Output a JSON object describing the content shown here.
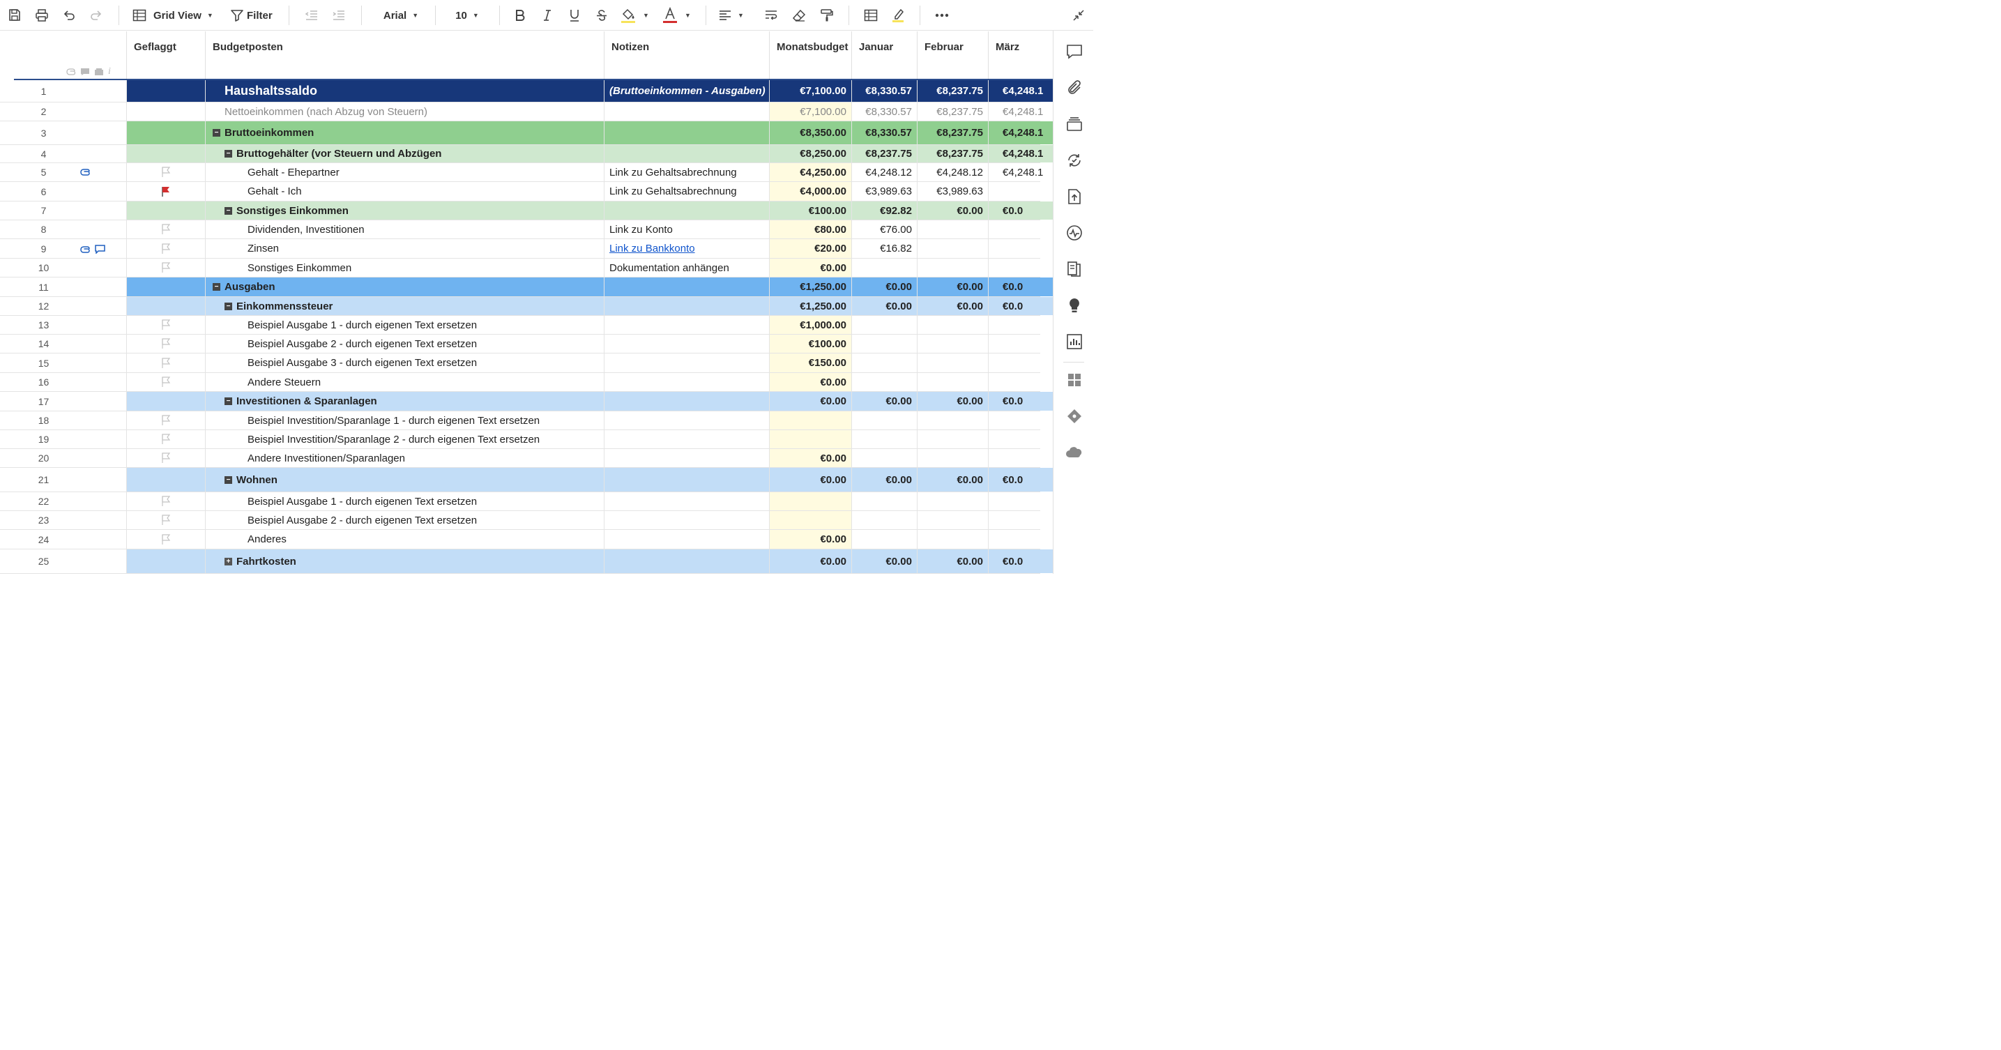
{
  "toolbar": {
    "view_label": "Grid View",
    "filter_label": "Filter",
    "font_family": "Arial",
    "font_size": "10",
    "fill_color": "#f7e35a",
    "text_color": "#d32f2f"
  },
  "columns": {
    "flagged": "Geflaggt",
    "item": "Budgetposten",
    "notes": "Notizen",
    "monthly": "Monatsbudget",
    "jan": "Januar",
    "feb": "Februar",
    "mar": "März"
  },
  "colors": {
    "balance_bg": "#17377a",
    "income_bg": "#8fcf8f",
    "income_sub_bg": "#cfe8cf",
    "expense_bg": "#6fb3f0",
    "expense_sub_bg": "#c2ddf7",
    "budget_col_bg": "#fffbe0",
    "flag_red": "#d32f2f"
  },
  "rows": [
    {
      "n": "1",
      "item": "Haushaltssaldo",
      "notes": "(Bruttoeinkommen - Ausgaben)",
      "mb": "€7,100.00",
      "jan": "€8,330.57",
      "feb": "€8,237.75",
      "mar": "€4,248.1"
    },
    {
      "n": "2",
      "item": "Nettoeinkommen (nach Abzug von Steuern)",
      "notes": "",
      "mb": "€7,100.00",
      "jan": "€8,330.57",
      "feb": "€8,237.75",
      "mar": "€4,248.1"
    },
    {
      "n": "3",
      "item": "Bruttoeinkommen",
      "notes": "",
      "mb": "€8,350.00",
      "jan": "€8,330.57",
      "feb": "€8,237.75",
      "mar": "€4,248.1"
    },
    {
      "n": "4",
      "item": "Bruttogehälter (vor Steuern und Abzügen",
      "notes": "",
      "mb": "€8,250.00",
      "jan": "€8,237.75",
      "feb": "€8,237.75",
      "mar": "€4,248.1"
    },
    {
      "n": "5",
      "item": "Gehalt - Ehepartner",
      "notes": "Link zu Gehaltsabrechnung",
      "mb": "€4,250.00",
      "jan": "€4,248.12",
      "feb": "€4,248.12",
      "mar": "€4,248.1"
    },
    {
      "n": "6",
      "item": "Gehalt - Ich",
      "notes": "Link zu Gehaltsabrechnung",
      "mb": "€4,000.00",
      "jan": "€3,989.63",
      "feb": "€3,989.63",
      "mar": ""
    },
    {
      "n": "7",
      "item": "Sonstiges Einkommen",
      "notes": "",
      "mb": "€100.00",
      "jan": "€92.82",
      "feb": "€0.00",
      "mar": "€0.0"
    },
    {
      "n": "8",
      "item": "Dividenden, Investitionen",
      "notes": "Link zu Konto",
      "mb": "€80.00",
      "jan": "€76.00",
      "feb": "",
      "mar": ""
    },
    {
      "n": "9",
      "item": "Zinsen",
      "notes": "Link zu Bankkonto",
      "mb": "€20.00",
      "jan": "€16.82",
      "feb": "",
      "mar": ""
    },
    {
      "n": "10",
      "item": "Sonstiges Einkommen",
      "notes": "Dokumentation anhängen",
      "mb": "€0.00",
      "jan": "",
      "feb": "",
      "mar": ""
    },
    {
      "n": "11",
      "item": "Ausgaben",
      "notes": "",
      "mb": "€1,250.00",
      "jan": "€0.00",
      "feb": "€0.00",
      "mar": "€0.0"
    },
    {
      "n": "12",
      "item": "Einkommenssteuer",
      "notes": "",
      "mb": "€1,250.00",
      "jan": "€0.00",
      "feb": "€0.00",
      "mar": "€0.0"
    },
    {
      "n": "13",
      "item": "Beispiel Ausgabe 1 - durch eigenen Text ersetzen",
      "notes": "",
      "mb": "€1,000.00",
      "jan": "",
      "feb": "",
      "mar": ""
    },
    {
      "n": "14",
      "item": "Beispiel Ausgabe 2 - durch eigenen Text ersetzen",
      "notes": "",
      "mb": "€100.00",
      "jan": "",
      "feb": "",
      "mar": ""
    },
    {
      "n": "15",
      "item": "Beispiel Ausgabe 3 - durch eigenen Text ersetzen",
      "notes": "",
      "mb": "€150.00",
      "jan": "",
      "feb": "",
      "mar": ""
    },
    {
      "n": "16",
      "item": "Andere Steuern",
      "notes": "",
      "mb": "€0.00",
      "jan": "",
      "feb": "",
      "mar": ""
    },
    {
      "n": "17",
      "item": "Investitionen & Sparanlagen",
      "notes": "",
      "mb": "€0.00",
      "jan": "€0.00",
      "feb": "€0.00",
      "mar": "€0.0"
    },
    {
      "n": "18",
      "item": "Beispiel Investition/Sparanlage 1 - durch eigenen Text ersetzen",
      "notes": "",
      "mb": "",
      "jan": "",
      "feb": "",
      "mar": ""
    },
    {
      "n": "19",
      "item": "Beispiel Investition/Sparanlage 2 - durch eigenen Text ersetzen",
      "notes": "",
      "mb": "",
      "jan": "",
      "feb": "",
      "mar": ""
    },
    {
      "n": "20",
      "item": "Andere Investitionen/Sparanlagen",
      "notes": "",
      "mb": "€0.00",
      "jan": "",
      "feb": "",
      "mar": ""
    },
    {
      "n": "21",
      "item": "Wohnen",
      "notes": "",
      "mb": "€0.00",
      "jan": "€0.00",
      "feb": "€0.00",
      "mar": "€0.0"
    },
    {
      "n": "22",
      "item": "Beispiel Ausgabe 1 - durch eigenen Text ersetzen",
      "notes": "",
      "mb": "",
      "jan": "",
      "feb": "",
      "mar": ""
    },
    {
      "n": "23",
      "item": "Beispiel Ausgabe 2 - durch eigenen Text ersetzen",
      "notes": "",
      "mb": "",
      "jan": "",
      "feb": "",
      "mar": ""
    },
    {
      "n": "24",
      "item": "Anderes",
      "notes": "",
      "mb": "€0.00",
      "jan": "",
      "feb": "",
      "mar": ""
    },
    {
      "n": "25",
      "item": "Fahrtkosten",
      "notes": "",
      "mb": "€0.00",
      "jan": "€0.00",
      "feb": "€0.00",
      "mar": "€0.0"
    }
  ]
}
